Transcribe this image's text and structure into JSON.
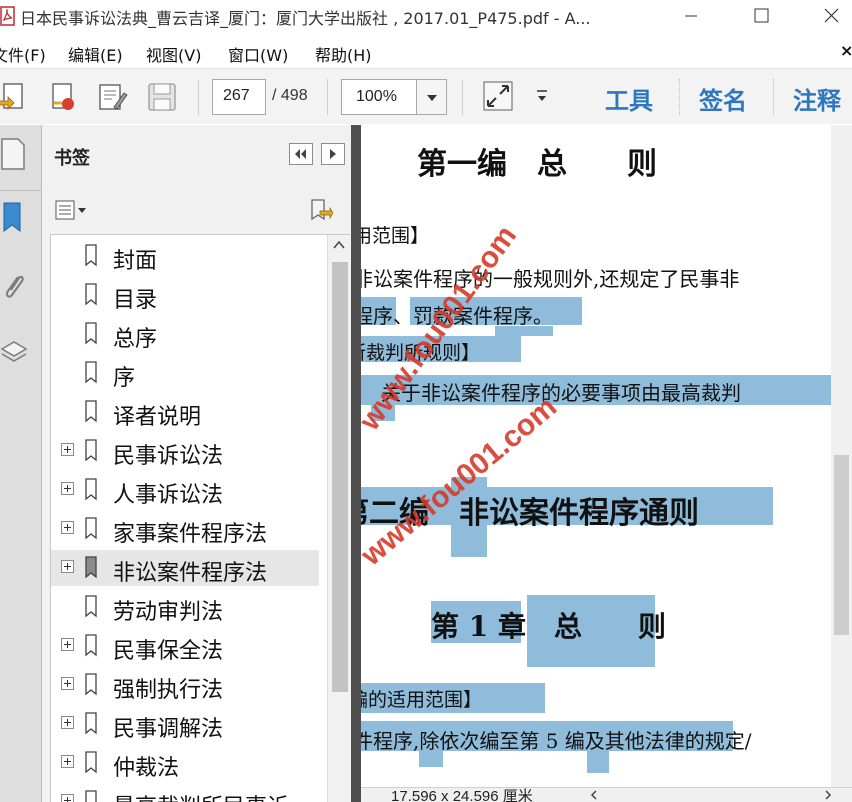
{
  "window": {
    "title": "日本民事诉讼法典_曹云吉译_厦门：厦门大学出版社 , 2017.01_P475.pdf - A..."
  },
  "menu": {
    "file": "文件(F)",
    "edit": "编辑(E)",
    "view": "视图(V)",
    "window": "窗口(W)",
    "help": "帮助(H)",
    "close": "×"
  },
  "toolbar": {
    "page_current": "267",
    "page_total": "/ 498",
    "zoom": "100%",
    "tools": "工具",
    "sign": "签名",
    "comment": "注释"
  },
  "bookmarks": {
    "title": "书签",
    "items": [
      {
        "label": "封面",
        "expandable": false
      },
      {
        "label": "目录",
        "expandable": false
      },
      {
        "label": "总序",
        "expandable": false
      },
      {
        "label": "序",
        "expandable": false
      },
      {
        "label": "译者说明",
        "expandable": false
      },
      {
        "label": "民事诉讼法",
        "expandable": true
      },
      {
        "label": "人事诉讼法",
        "expandable": true
      },
      {
        "label": "家事案件程序法",
        "expandable": true
      },
      {
        "label": "非讼案件程序法",
        "expandable": true,
        "selected": true
      },
      {
        "label": "劳动审判法",
        "expandable": false
      },
      {
        "label": "民事保全法",
        "expandable": true
      },
      {
        "label": "强制执行法",
        "expandable": true
      },
      {
        "label": "民事调解法",
        "expandable": true
      },
      {
        "label": "仲裁法",
        "expandable": true
      },
      {
        "label": "最高裁判所民事诉",
        "expandable": true
      }
    ]
  },
  "document": {
    "heading_top": "第一编　总　　则",
    "line1": "用范围】",
    "line2": "非讼案件程序的一般规则外,还规定了民事非",
    "line3": "程序、罚款案件程序。",
    "line4": "所裁判所规则】",
    "line5": "关于非讼案件程序的必要事项由最高裁判",
    "heading_part2": "第二编　非讼案件程序通则",
    "heading_ch1": "第 1 章　总　　则",
    "line6": "编的适用范围】",
    "line7": "件程序,除依次编至第 5 编及其他法律的规定/",
    "watermark1": "www.fou001.com",
    "watermark2": "www.fou001.com"
  },
  "status": {
    "page_size": "17.596 x 24.596 厘米"
  },
  "colors": {
    "accent": "#2d76c2",
    "highlight": "#8fbcda",
    "watermark": "#d63b2b"
  }
}
